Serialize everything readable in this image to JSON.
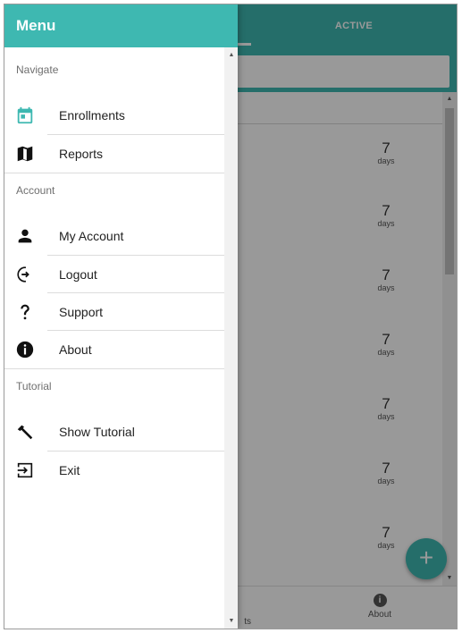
{
  "app": {
    "tabs": {
      "left_label": "",
      "active_label": "ACTIVE"
    },
    "list_rows": [
      {
        "value": "7",
        "unit": "days"
      },
      {
        "value": "7",
        "unit": "days"
      },
      {
        "value": "7",
        "unit": "days"
      },
      {
        "value": "7",
        "unit": "days"
      },
      {
        "value": "7",
        "unit": "days"
      },
      {
        "value": "7",
        "unit": "days"
      },
      {
        "value": "7",
        "unit": "days"
      }
    ],
    "fab_label": "+",
    "bottom_nav": {
      "reports_partial_label": "ts",
      "about_label": "About",
      "about_icon_glyph": "i"
    }
  },
  "drawer": {
    "title": "Menu",
    "sections": [
      {
        "title": "Navigate",
        "items": [
          {
            "label": "Enrollments",
            "icon": "calendar-icon"
          },
          {
            "label": "Reports",
            "icon": "map-icon"
          }
        ]
      },
      {
        "title": "Account",
        "items": [
          {
            "label": "My Account",
            "icon": "person-icon"
          },
          {
            "label": "Logout",
            "icon": "logout-icon"
          },
          {
            "label": "Support",
            "icon": "question-icon"
          },
          {
            "label": "About",
            "icon": "info-icon"
          }
        ]
      },
      {
        "title": "Tutorial",
        "items": [
          {
            "label": "Show Tutorial",
            "icon": "hammer-icon"
          },
          {
            "label": "Exit",
            "icon": "exit-icon"
          }
        ]
      }
    ]
  },
  "colors": {
    "accent": "#3eb8b1",
    "calendar_icon": "#3eb8b1",
    "icon_dark": "#111111",
    "overlay": "rgba(0,0,0,0.4)"
  }
}
